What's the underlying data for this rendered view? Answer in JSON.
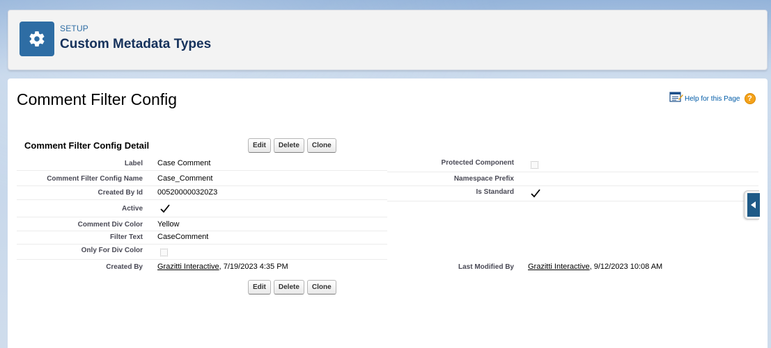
{
  "header": {
    "eyebrow": "SETUP",
    "title": "Custom Metadata Types",
    "icon": "gear-icon"
  },
  "page": {
    "title": "Comment Filter Config",
    "help_link": "Help for this Page",
    "help_icon": "?"
  },
  "detail": {
    "section_title": "Comment Filter Config Detail",
    "buttons": {
      "edit": "Edit",
      "delete": "Delete",
      "clone": "Clone"
    },
    "fields": {
      "label": {
        "label": "Label",
        "value": "Case Comment"
      },
      "name": {
        "label": "Comment Filter Config Name",
        "value": "Case_Comment"
      },
      "created_by_id": {
        "label": "Created By Id",
        "value": "005200000320Z3"
      },
      "active": {
        "label": "Active",
        "checked": true
      },
      "comment_div_color": {
        "label": "Comment Div Color",
        "value": "Yellow"
      },
      "filter_text": {
        "label": "Filter Text",
        "value": "CaseComment"
      },
      "only_for_div_color": {
        "label": "Only For Div Color",
        "checked": false
      },
      "created_by": {
        "label": "Created By",
        "user": "Grazitti Interactive",
        "date": ", 7/19/2023 4:35 PM"
      },
      "protected_component": {
        "label": "Protected Component",
        "checked": false
      },
      "namespace_prefix": {
        "label": "Namespace Prefix",
        "value": ""
      },
      "is_standard": {
        "label": "Is Standard",
        "checked": true
      },
      "last_modified_by": {
        "label": "Last Modified By",
        "user": "Grazitti Interactive",
        "date": ", 9/12/2023 10:08 AM"
      }
    }
  },
  "colors": {
    "brand": "#2e6da4",
    "title_text": "#16325c",
    "link": "#015ba7"
  }
}
